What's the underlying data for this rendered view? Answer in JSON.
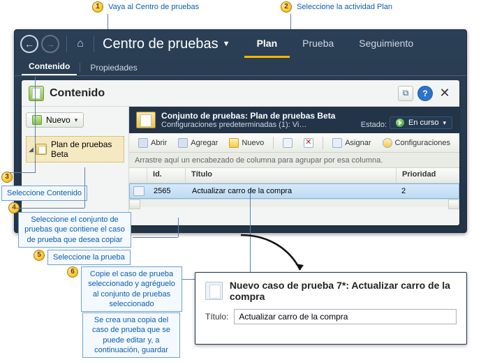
{
  "callouts": {
    "c1": "Vaya al Centro de pruebas",
    "c2": "Seleccione la actividad Plan",
    "c3": "Seleccione Contenido",
    "c4": "Seleccione el conjunto de pruebas que contiene el caso de prueba que desea copiar",
    "c5": "Seleccione la prueba",
    "c6": "Copie el caso de prueba seleccionado y agréguelo al conjunto de pruebas seleccionado",
    "c7": "Se crea una copia del caso de prueba que se puede editar y, a continuación, guardar"
  },
  "breadcrumb": "Centro de pruebas",
  "activities": {
    "plan": "Plan",
    "prueba": "Prueba",
    "seg": "Seguimiento"
  },
  "subtabs": {
    "contenido": "Contenido",
    "props": "Propiedades"
  },
  "panel": {
    "title": "Contenido"
  },
  "tree": {
    "new": "Nuevo",
    "item1": "Plan de pruebas Beta"
  },
  "suite": {
    "title": "Conjunto de pruebas: Plan de pruebas Beta",
    "subtitle": "Configuraciones predeterminadas (1): Vi…",
    "state_label": "Estado:",
    "state_val": "En curso"
  },
  "toolbar": {
    "abrir": "Abrir",
    "agregar": "Agregar",
    "nuevo": "Nuevo",
    "asignar": "Asignar",
    "config": "Configuraciones"
  },
  "groupbar": "Arrastre aquí un encabezado de columna para agrupar por esa columna.",
  "grid": {
    "h_id": "Id.",
    "h_title": "Título",
    "h_pri": "Prioridad",
    "r1_id": "2565",
    "r1_title": "Actualizar carro de la compra",
    "r1_pri": "2"
  },
  "newcase": {
    "title": "Nuevo caso de prueba 7*: Actualizar carro de la compra",
    "field_label": "Título:",
    "field_value": "Actualizar carro de la compra"
  }
}
